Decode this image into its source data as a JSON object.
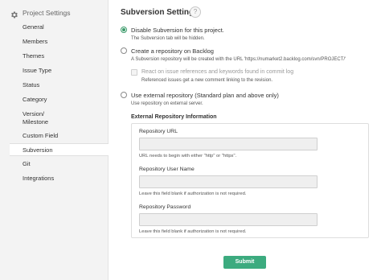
{
  "sidebar": {
    "title": "Project Settings",
    "items": [
      {
        "label": "General"
      },
      {
        "label": "Members"
      },
      {
        "label": "Themes"
      },
      {
        "label": "Issue Type"
      },
      {
        "label": "Status"
      },
      {
        "label": "Category"
      },
      {
        "label": "Version/"
      },
      {
        "label": "Milestone"
      },
      {
        "label": "Custom Field"
      },
      {
        "label": "Subversion"
      },
      {
        "label": "Git"
      },
      {
        "label": "Integrations"
      }
    ],
    "active": "Subversion"
  },
  "main": {
    "title": "Subversion Settings",
    "help": "?",
    "options": {
      "disable": {
        "label": "Disable Subversion for this project.",
        "help": "The Subversion tab will be hidden.",
        "checked": true
      },
      "create": {
        "label": "Create a repository on Backlog",
        "help": "A Subversion repository will be created with the URL 'https://numarket2.backlog.com/svn/PROJECT/'",
        "checked": false
      },
      "react": {
        "label": "React on issue references and keywords found in commit log",
        "help": "Referenced issues get a new comment linking to the revision.",
        "checked": false
      },
      "external": {
        "label": "Use external repository (Standard plan and above only)",
        "help": "Use repository on external server.",
        "checked": false
      }
    },
    "external_section": {
      "title": "External Repository Information",
      "url": {
        "label": "Repository URL",
        "value": "",
        "help": "URL needs to begin with either \"http\" or \"https\"."
      },
      "username": {
        "label": "Repository User Name",
        "value": "",
        "help": "Leave this field blank if authorization is not required."
      },
      "password": {
        "label": "Repository Password",
        "value": "",
        "help": "Leave this field blank if authorization is not required."
      }
    },
    "submit_label": "Submit"
  },
  "colors": {
    "accent": "#3cab7f",
    "sidebar_bg": "#f3f3f3"
  }
}
